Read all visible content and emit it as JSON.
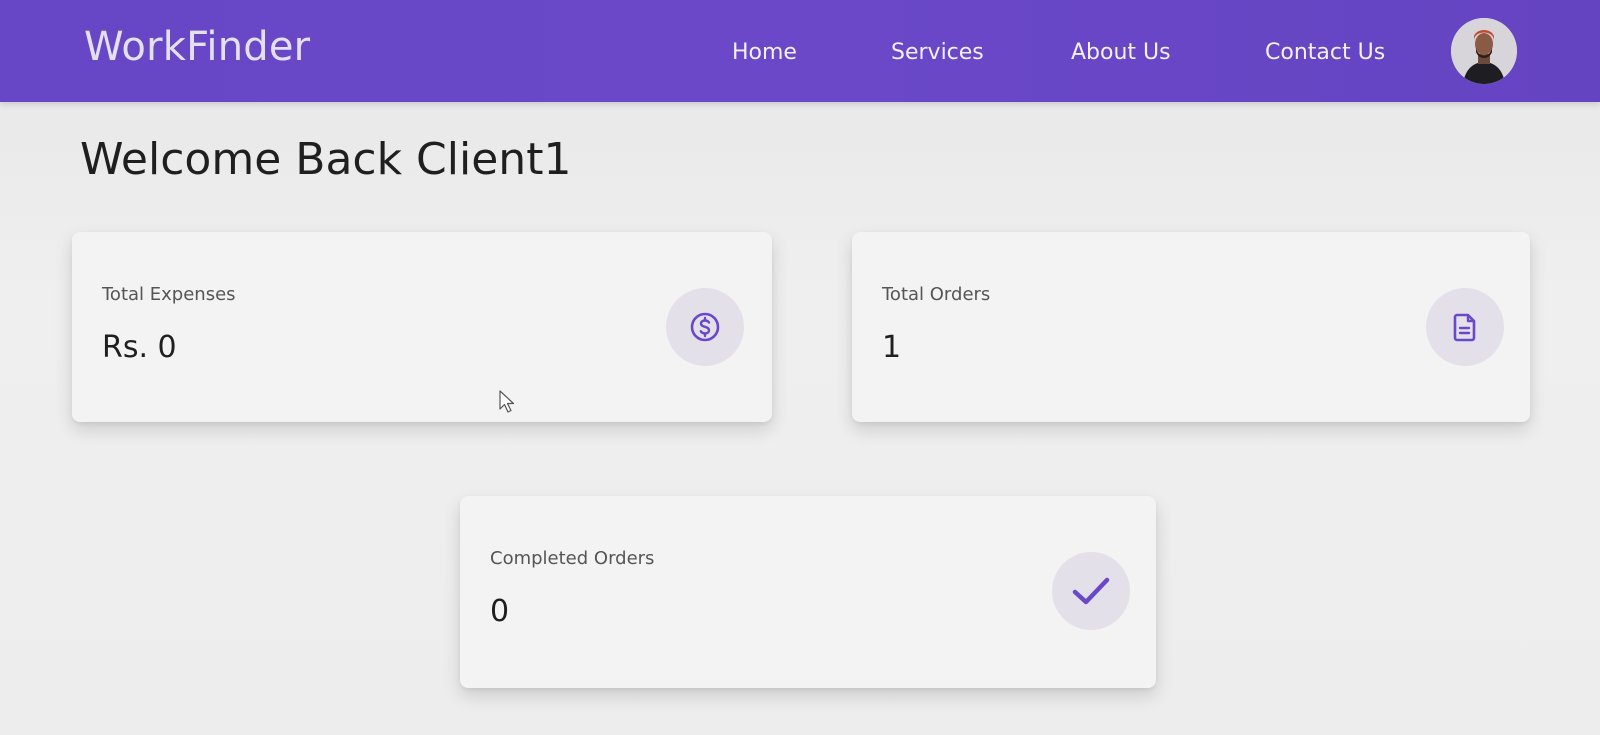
{
  "navbar": {
    "brand": "WorkFinder",
    "links": [
      "Home",
      "Services",
      "About Us",
      "Contact Us"
    ],
    "avatar_icon": "user-avatar-icon"
  },
  "welcome": "Welcome Back Client1",
  "cards": [
    {
      "label": "Total Expenses",
      "value": "Rs. 0",
      "icon": "dollar-circle-icon"
    },
    {
      "label": "Total Orders",
      "value": "1",
      "icon": "document-icon"
    },
    {
      "label": "Completed Orders",
      "value": "0",
      "icon": "check-icon"
    }
  ],
  "colors": {
    "navbar": "#6847c6",
    "accent": "#6a48c8",
    "icon_bg": "#e3e0ea",
    "page_bg": "#ececec"
  }
}
